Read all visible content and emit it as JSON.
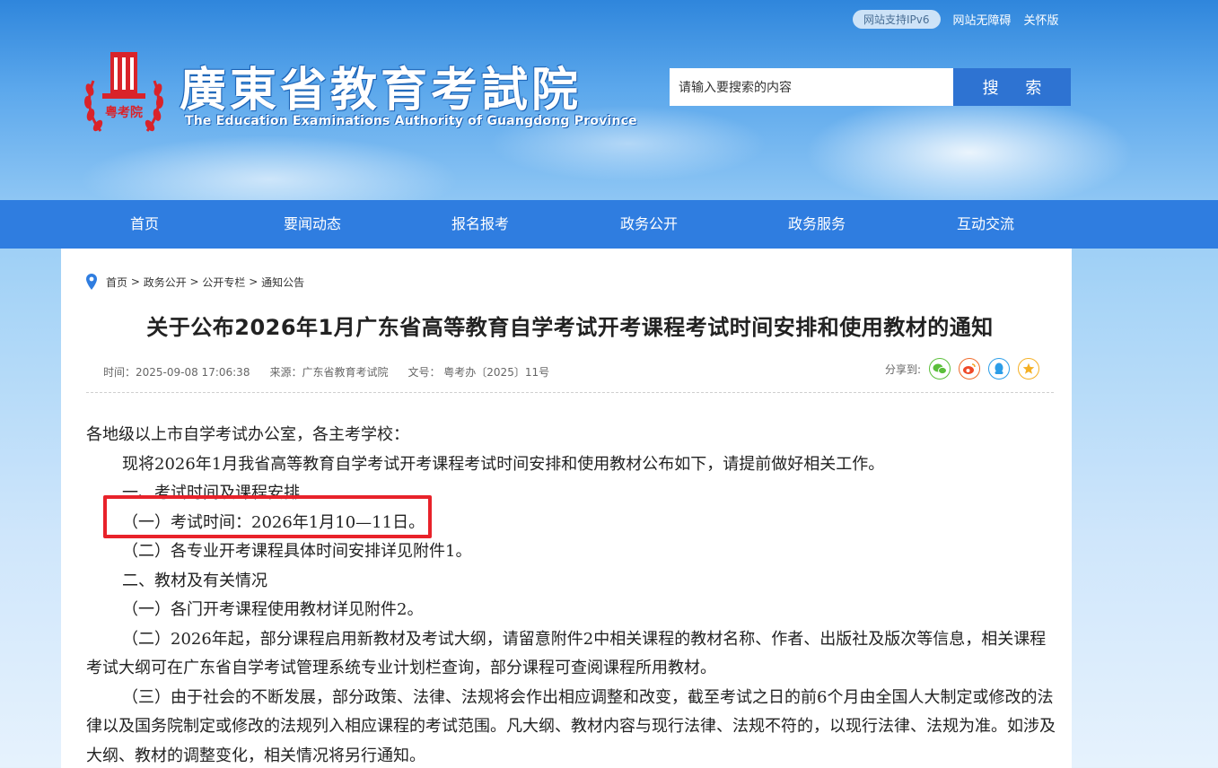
{
  "header": {
    "ipv6_badge": "网站支持IPv6",
    "accessibility_link": "网站无障碍",
    "care_link": "关怀版",
    "site_title": "廣東省教育考試院",
    "site_subtitle": "The Education Examinations Authority of Guangdong Province",
    "emblem_text": "粤考院",
    "search_placeholder": "请输入要搜索的内容",
    "search_button": "搜 索"
  },
  "nav": {
    "items": [
      {
        "label": "首页"
      },
      {
        "label": "要闻动态"
      },
      {
        "label": "报名报考"
      },
      {
        "label": "政务公开"
      },
      {
        "label": "政务服务"
      },
      {
        "label": "互动交流"
      }
    ]
  },
  "breadcrumb": {
    "items": [
      "首页",
      "政务公开",
      "公开专栏",
      "通知公告"
    ],
    "separator": " > "
  },
  "article": {
    "title": "关于公布2026年1月广东省高等教育自学考试开考课程考试时间安排和使用教材的通知",
    "time": "时间：2025-09-08 17:06:38",
    "source": "来源：广东省教育考试院",
    "doc_no": "文号： 粤考办〔2025〕11号",
    "share_label": "分享到:",
    "share_icons": [
      "wechat-icon",
      "weibo-icon",
      "qq-icon",
      "qzone-icon"
    ],
    "paragraphs": [
      "各地级以上市自学考试办公室，各主考学校：",
      "现将2026年1月我省高等教育自学考试开考课程考试时间安排和使用教材公布如下，请提前做好相关工作。",
      "一、考试时间及课程安排",
      "（一）考试时间：2026年1月10—11日。",
      "（二）各专业开考课程具体时间安排详见附件1。",
      "二、教材及有关情况",
      "（一）各门开考课程使用教材详见附件2。",
      "（二）2026年起，部分课程启用新教材及考试大纲，请留意附件2中相关课程的教材名称、作者、出版社及版次等信息，相关课程考试大纲可在广东省自学考试管理系统专业计划栏查询，部分课程可查阅课程所用教材。",
      "（三）由于社会的不断发展，部分政策、法律、法规将会作出相应调整和改变，截至考试之日的前6个月由全国人大制定或修改的法律以及国务院制定或修改的法规列入相应课程的考试范围。凡大纲、教材内容与现行法律、法规不符的，以现行法律、法规为准。如涉及大纲、教材的调整变化，相关情况将另行通知。"
    ]
  },
  "colors": {
    "nav_bg": "#2f7de0",
    "search_button_bg": "#2e73d2",
    "emblem_red": "#d9232a",
    "highlight_border": "#e8222a"
  }
}
